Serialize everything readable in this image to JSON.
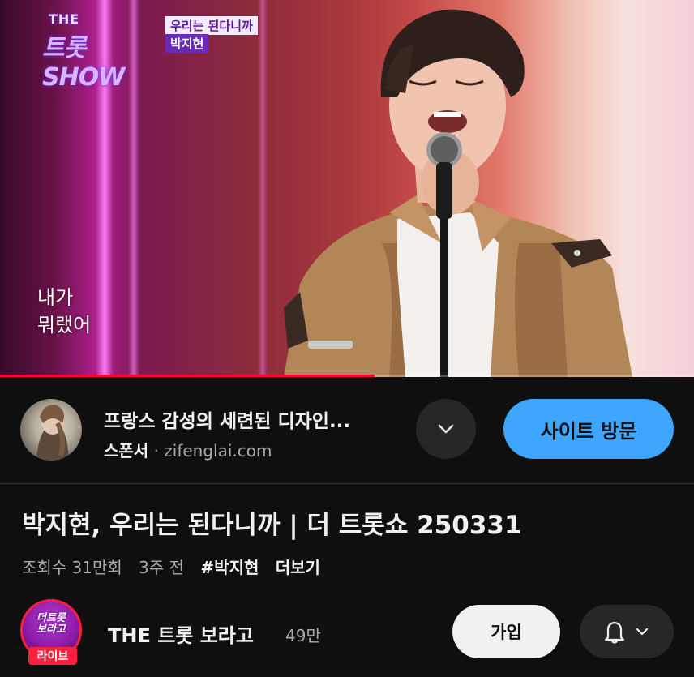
{
  "video": {
    "logo_top": "THE",
    "logo_main": "트롯SHOW",
    "song_tag": "우리는 된다니까",
    "artist_tag": "박지현",
    "lyric_line1": "내가",
    "lyric_line2": "뭐랬어",
    "progress_fraction": 0.54
  },
  "ad": {
    "title": "프랑스 감성의 세련된 디자인...",
    "sponsor_label": "스폰서",
    "separator": "·",
    "domain": "zifenglai.com",
    "expand_icon": "chevron-down-icon",
    "visit_label": "사이트 방문",
    "accent": "#3ea6ff"
  },
  "video_info": {
    "title": "박지현, 우리는 된다니까 | 더 트롯쇼 250331",
    "views": "조회수 31만회",
    "age": "3주 전",
    "hashtag": "#박지현",
    "more_label": "더보기"
  },
  "channel": {
    "avatar_text_line1": "더트롯",
    "avatar_text_line2": "보라고",
    "live_label": "라이브",
    "name": "THE 트롯 보라고",
    "subscribers": "49만",
    "join_label": "가입",
    "bell_icon": "bell-icon",
    "bell_dropdown_icon": "chevron-down-icon",
    "live_color": "#ff1f3d"
  }
}
